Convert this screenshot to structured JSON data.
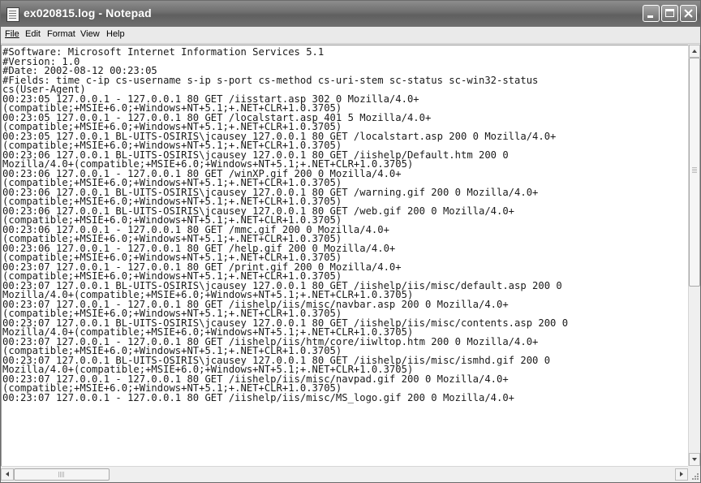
{
  "window": {
    "title": "ex020815.log - Notepad",
    "icon": "notepad-icon",
    "controls": {
      "minimize": "minimize-icon",
      "maximize": "maximize-icon",
      "close": "close-icon"
    }
  },
  "menu": {
    "file": "File",
    "edit": "Edit",
    "format": "Format",
    "view": "View",
    "help": "Help"
  },
  "document": {
    "lines": [
      "#Software: Microsoft Internet Information Services 5.1",
      "#Version: 1.0",
      "#Date: 2002-08-12 00:23:05",
      "#Fields: time c-ip cs-username s-ip s-port cs-method cs-uri-stem sc-status sc-win32-status",
      "cs(User-Agent)",
      "00:23:05 127.0.0.1 - 127.0.0.1 80 GET /iisstart.asp 302 0 Mozilla/4.0+",
      "(compatible;+MSIE+6.0;+Windows+NT+5.1;+.NET+CLR+1.0.3705)",
      "00:23:05 127.0.0.1 - 127.0.0.1 80 GET /localstart.asp 401 5 Mozilla/4.0+",
      "(compatible;+MSIE+6.0;+Windows+NT+5.1;+.NET+CLR+1.0.3705)",
      "00:23:05 127.0.0.1 BL-UITS-OSIRIS\\jcausey 127.0.0.1 80 GET /localstart.asp 200 0 Mozilla/4.0+",
      "(compatible;+MSIE+6.0;+Windows+NT+5.1;+.NET+CLR+1.0.3705)",
      "00:23:06 127.0.0.1 BL-UITS-OSIRIS\\jcausey 127.0.0.1 80 GET /iishelp/Default.htm 200 0",
      "Mozilla/4.0+(compatible;+MSIE+6.0;+Windows+NT+5.1;+.NET+CLR+1.0.3705)",
      "00:23:06 127.0.0.1 - 127.0.0.1 80 GET /winXP.gif 200 0 Mozilla/4.0+",
      "(compatible;+MSIE+6.0;+Windows+NT+5.1;+.NET+CLR+1.0.3705)",
      "00:23:06 127.0.0.1 BL-UITS-OSIRIS\\jcausey 127.0.0.1 80 GET /warning.gif 200 0 Mozilla/4.0+",
      "(compatible;+MSIE+6.0;+Windows+NT+5.1;+.NET+CLR+1.0.3705)",
      "00:23:06 127.0.0.1 BL-UITS-OSIRIS\\jcausey 127.0.0.1 80 GET /web.gif 200 0 Mozilla/4.0+",
      "(compatible;+MSIE+6.0;+Windows+NT+5.1;+.NET+CLR+1.0.3705)",
      "00:23:06 127.0.0.1 - 127.0.0.1 80 GET /mmc.gif 200 0 Mozilla/4.0+",
      "(compatible;+MSIE+6.0;+Windows+NT+5.1;+.NET+CLR+1.0.3705)",
      "00:23:06 127.0.0.1 - 127.0.0.1 80 GET /help.gif 200 0 Mozilla/4.0+",
      "(compatible;+MSIE+6.0;+Windows+NT+5.1;+.NET+CLR+1.0.3705)",
      "00:23:07 127.0.0.1 - 127.0.0.1 80 GET /print.gif 200 0 Mozilla/4.0+",
      "(compatible;+MSIE+6.0;+Windows+NT+5.1;+.NET+CLR+1.0.3705)",
      "00:23:07 127.0.0.1 BL-UITS-OSIRIS\\jcausey 127.0.0.1 80 GET /iishelp/iis/misc/default.asp 200 0",
      "Mozilla/4.0+(compatible;+MSIE+6.0;+Windows+NT+5.1;+.NET+CLR+1.0.3705)",
      "00:23:07 127.0.0.1 - 127.0.0.1 80 GET /iishelp/iis/misc/navbar.asp 200 0 Mozilla/4.0+",
      "(compatible;+MSIE+6.0;+Windows+NT+5.1;+.NET+CLR+1.0.3705)",
      "00:23:07 127.0.0.1 BL-UITS-OSIRIS\\jcausey 127.0.0.1 80 GET /iishelp/iis/misc/contents.asp 200 0",
      "Mozilla/4.0+(compatible;+MSIE+6.0;+Windows+NT+5.1;+.NET+CLR+1.0.3705)",
      "00:23:07 127.0.0.1 - 127.0.0.1 80 GET /iishelp/iis/htm/core/iiwltop.htm 200 0 Mozilla/4.0+",
      "(compatible;+MSIE+6.0;+Windows+NT+5.1;+.NET+CLR+1.0.3705)",
      "00:23:07 127.0.0.1 BL-UITS-OSIRIS\\jcausey 127.0.0.1 80 GET /iishelp/iis/misc/ismhd.gif 200 0",
      "Mozilla/4.0+(compatible;+MSIE+6.0;+Windows+NT+5.1;+.NET+CLR+1.0.3705)",
      "00:23:07 127.0.0.1 - 127.0.0.1 80 GET /iishelp/iis/misc/navpad.gif 200 0 Mozilla/4.0+",
      "(compatible;+MSIE+6.0;+Windows+NT+5.1;+.NET+CLR+1.0.3705)",
      "00:23:07 127.0.0.1 - 127.0.0.1 80 GET /iishelp/iis/misc/MS_logo.gif 200 0 Mozilla/4.0+"
    ]
  },
  "colors": {
    "titlebar": "#6d6d6d",
    "title_text": "#ffffff",
    "editor_background": "#ffffff",
    "editor_text": "#1a1a1a"
  }
}
